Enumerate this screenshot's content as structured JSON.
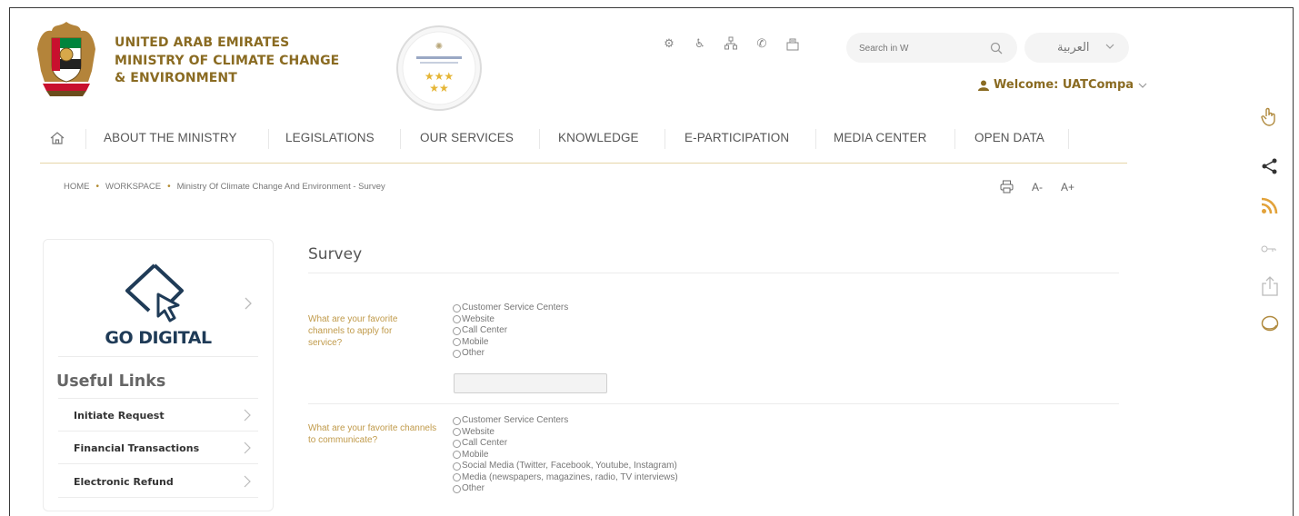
{
  "header": {
    "org_line1": "UNITED ARAB EMIRATES",
    "org_line2": "MINISTRY OF CLIMATE CHANGE",
    "org_line3": "& ENVIRONMENT",
    "top_icons": [
      "settings-icon",
      "accessibility-icon",
      "sitemap-icon",
      "phone-icon",
      "feedback-icon"
    ],
    "search_placeholder": "Search in W",
    "language": "العربية",
    "welcome": "Welcome: UATCompa"
  },
  "nav": {
    "items": [
      "ABOUT THE MINISTRY",
      "LEGISLATIONS",
      "OUR SERVICES",
      "KNOWLEDGE",
      "E-PARTICIPATION",
      "MEDIA CENTER",
      "OPEN DATA"
    ]
  },
  "breadcrumb": {
    "items": [
      "HOME",
      "WORKSPACE",
      "Ministry Of Climate Change And Environment - Survey"
    ]
  },
  "tools": {
    "font_decrease": "A-",
    "font_increase": "A+"
  },
  "sidebar": {
    "go_digital": "GO DIGITAL",
    "useful_links_title": "Useful Links",
    "links": [
      "Initiate Request",
      "Financial Transactions",
      "Electronic Refund"
    ]
  },
  "survey": {
    "title": "Survey",
    "q1": {
      "label": "What are your favorite channels to apply for service?",
      "options": [
        "Customer Service Centers",
        "Website",
        "Call Center",
        "Mobile",
        "Other"
      ]
    },
    "q2": {
      "label": "What are your favorite channels to communicate?",
      "options": [
        "Customer Service Centers",
        "Website",
        "Call Center",
        "Mobile",
        "Social Media (Twitter, Facebook, Youtube, Instagram)",
        "Media (newspapers, magazines, radio, TV interviews)",
        "Other"
      ]
    }
  },
  "right_rail": [
    "touch-icon",
    "share-icon",
    "rss-icon",
    "key-icon",
    "upload-icon",
    "chat-icon"
  ],
  "colors": {
    "brand_gold": "#8a6b22",
    "question_gold": "#c09a4a",
    "rss_orange": "#e2a23a",
    "navy": "#1f3b57"
  }
}
